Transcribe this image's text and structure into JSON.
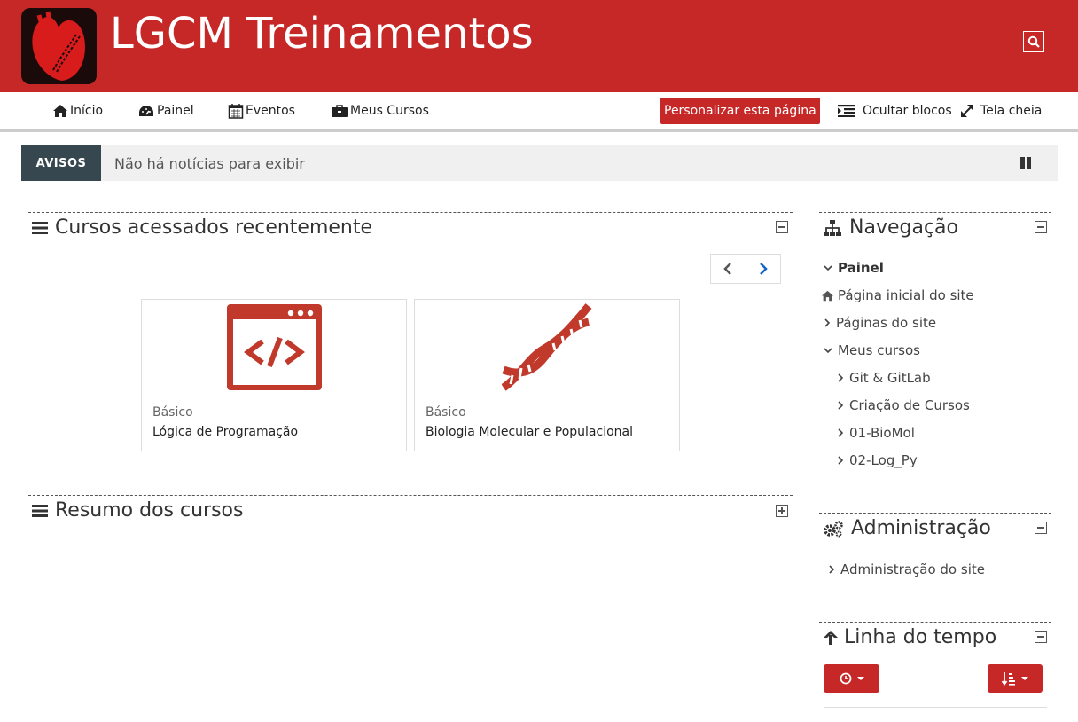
{
  "header": {
    "site_title": "LGCM Treinamentos",
    "logo_icon": "heart-logo-icon",
    "search_icon": "search-icon"
  },
  "navbar": {
    "items": [
      {
        "label": "Início",
        "icon": "home-icon"
      },
      {
        "label": "Painel",
        "icon": "dashboard-icon"
      },
      {
        "label": "Eventos",
        "icon": "calendar-icon"
      },
      {
        "label": "Meus Cursos",
        "icon": "briefcase-icon"
      }
    ],
    "customize_label": "Personalizar esta página",
    "hide_blocks_label": "Ocultar blocos",
    "fullscreen_label": "Tela cheia"
  },
  "news": {
    "label": "AVISOS",
    "text": "Não há notícias para exibir"
  },
  "recent_courses": {
    "title": "Cursos acessados recentemente",
    "courses": [
      {
        "category": "Básico",
        "name": "Lógica de Programação",
        "icon": "code-window-icon"
      },
      {
        "category": "Básico",
        "name": "Biologia Molecular e Populacional",
        "icon": "dna-icon"
      }
    ]
  },
  "course_overview": {
    "title": "Resumo dos cursos"
  },
  "navigation": {
    "title": "Navegação",
    "items": [
      {
        "label": "Painel"
      },
      {
        "label": "Página inicial do site"
      },
      {
        "label": "Páginas do site"
      },
      {
        "label": "Meus cursos"
      },
      {
        "label": "Git & GitLab"
      },
      {
        "label": "Criação de Cursos"
      },
      {
        "label": "01-BioMol"
      },
      {
        "label": "02-Log_Py"
      }
    ]
  },
  "administration": {
    "title": "Administração",
    "items": [
      {
        "label": "Administração do site"
      }
    ]
  },
  "timeline": {
    "title": "Linha do tempo"
  },
  "colors": {
    "brand_red": "#c62828",
    "news_label_bg": "#37474f"
  }
}
